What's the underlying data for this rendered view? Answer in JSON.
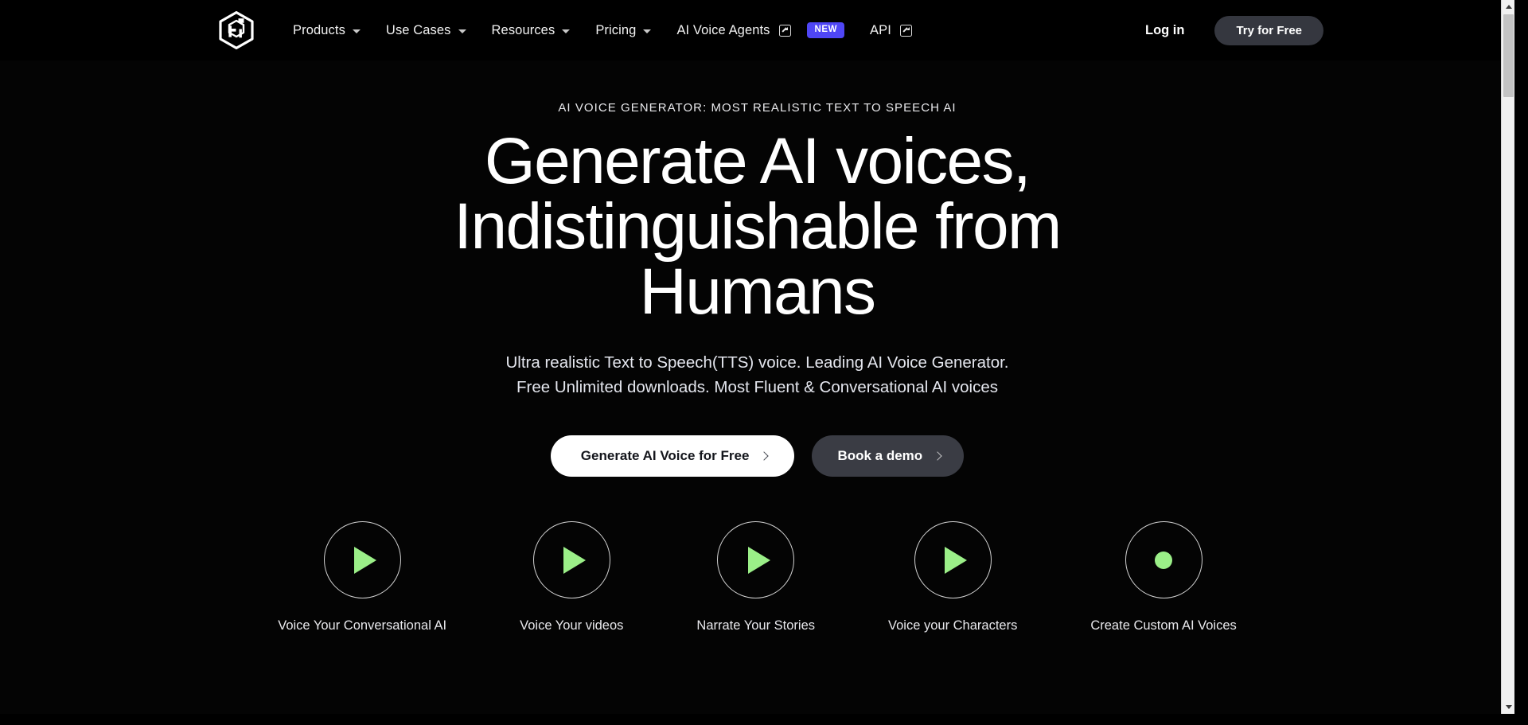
{
  "brand": {
    "logo_icon": "hexagon-cube-logo"
  },
  "nav": {
    "items": [
      {
        "label": "Products",
        "icon": "chevron-down-icon",
        "has_caret": true,
        "external": false,
        "badge": null
      },
      {
        "label": "Use Cases",
        "icon": "chevron-down-icon",
        "has_caret": true,
        "external": false,
        "badge": null
      },
      {
        "label": "Resources",
        "icon": "chevron-down-icon",
        "has_caret": true,
        "external": false,
        "badge": null
      },
      {
        "label": "Pricing",
        "icon": "chevron-down-icon",
        "has_caret": true,
        "external": false,
        "badge": null
      },
      {
        "label": "AI Voice Agents",
        "icon": "external-link-icon",
        "has_caret": false,
        "external": true,
        "badge": "NEW"
      },
      {
        "label": "API",
        "icon": "external-link-icon",
        "has_caret": false,
        "external": true,
        "badge": null
      }
    ],
    "login_label": "Log in",
    "cta_label": "Try for Free",
    "badge_color": "#4f46f5",
    "cta_bg": "#35373f"
  },
  "hero": {
    "eyebrow": "AI VOICE GENERATOR: MOST REALISTIC TEXT TO SPEECH AI",
    "headline": "Generate AI voices, Indistinguishable from Humans",
    "subhead_line1": "Ultra realistic Text to Speech(TTS) voice. Leading AI Voice Generator.",
    "subhead_line2": "Free Unlimited downloads. Most Fluent & Conversational AI voices",
    "primary_cta": "Generate AI Voice for Free",
    "secondary_cta": "Book a demo"
  },
  "usecases": {
    "accent_color": "#9bef88",
    "items": [
      {
        "label": "Voice Your Conversational AI",
        "icon": "play-icon"
      },
      {
        "label": "Voice Your videos",
        "icon": "play-icon"
      },
      {
        "label": "Narrate Your Stories",
        "icon": "play-icon"
      },
      {
        "label": "Voice your Characters",
        "icon": "play-icon"
      },
      {
        "label": "Create Custom AI Voices",
        "icon": "record-dot-icon"
      }
    ]
  }
}
